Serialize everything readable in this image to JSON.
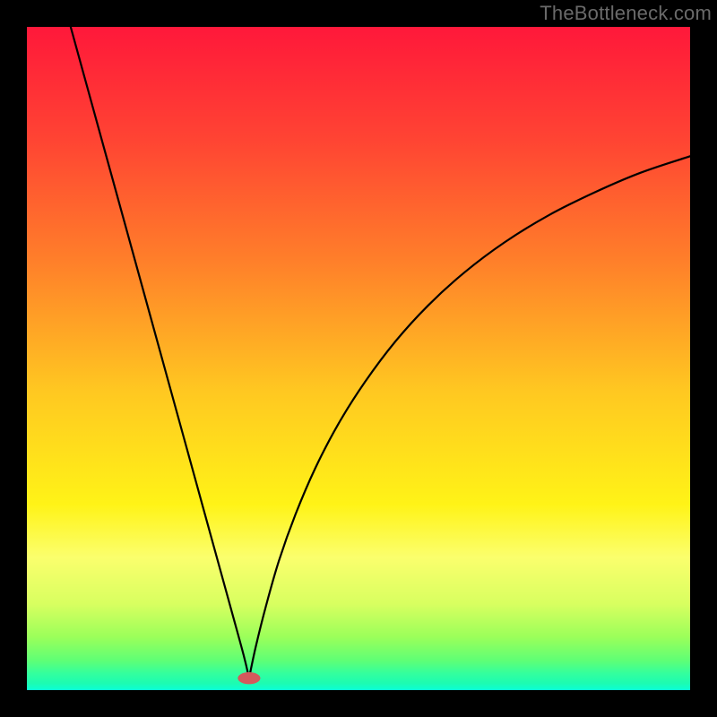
{
  "watermark": "TheBottleneck.com",
  "chart_data": {
    "type": "line",
    "title": "",
    "xlabel": "",
    "ylabel": "",
    "xlim": [
      0,
      1
    ],
    "ylim": [
      0,
      1
    ],
    "grid": false,
    "legend": false,
    "annotations": [],
    "description": "V-shaped curve plotted over a vertical rainbow gradient (red top through orange, yellow, green at bottom) with a black border. A small red rounded marker sits at the vertex of the V near the bottom.",
    "background_gradient_stops": [
      {
        "offset": 0.0,
        "color": "#ff183a"
      },
      {
        "offset": 0.17,
        "color": "#ff4433"
      },
      {
        "offset": 0.35,
        "color": "#ff7e2a"
      },
      {
        "offset": 0.55,
        "color": "#ffc821"
      },
      {
        "offset": 0.72,
        "color": "#fff317"
      },
      {
        "offset": 0.8,
        "color": "#fbff6d"
      },
      {
        "offset": 0.87,
        "color": "#d8ff60"
      },
      {
        "offset": 0.92,
        "color": "#9bff5a"
      },
      {
        "offset": 0.955,
        "color": "#5fff75"
      },
      {
        "offset": 0.975,
        "color": "#33ff9e"
      },
      {
        "offset": 0.99,
        "color": "#1cfcb2"
      },
      {
        "offset": 1.0,
        "color": "#0affd6"
      }
    ],
    "vertex": {
      "x": 0.335,
      "y": 0.982
    },
    "marker": {
      "x": 0.335,
      "y": 0.982,
      "rx": 0.017,
      "ry": 0.009,
      "color": "#d45a5c"
    },
    "series": [
      {
        "name": "left-branch",
        "x": [
          0.066,
          0.093,
          0.12,
          0.147,
          0.174,
          0.201,
          0.228,
          0.255,
          0.282,
          0.309,
          0.327,
          0.335
        ],
        "y": [
          0.0,
          0.098,
          0.196,
          0.294,
          0.392,
          0.49,
          0.588,
          0.686,
          0.784,
          0.882,
          0.948,
          0.982
        ]
      },
      {
        "name": "right-branch",
        "x": [
          0.335,
          0.345,
          0.36,
          0.38,
          0.405,
          0.435,
          0.47,
          0.51,
          0.555,
          0.605,
          0.66,
          0.72,
          0.785,
          0.855,
          0.925,
          1.0
        ],
        "y": [
          0.982,
          0.935,
          0.875,
          0.805,
          0.735,
          0.665,
          0.598,
          0.535,
          0.475,
          0.42,
          0.37,
          0.325,
          0.285,
          0.25,
          0.22,
          0.195
        ]
      }
    ]
  }
}
